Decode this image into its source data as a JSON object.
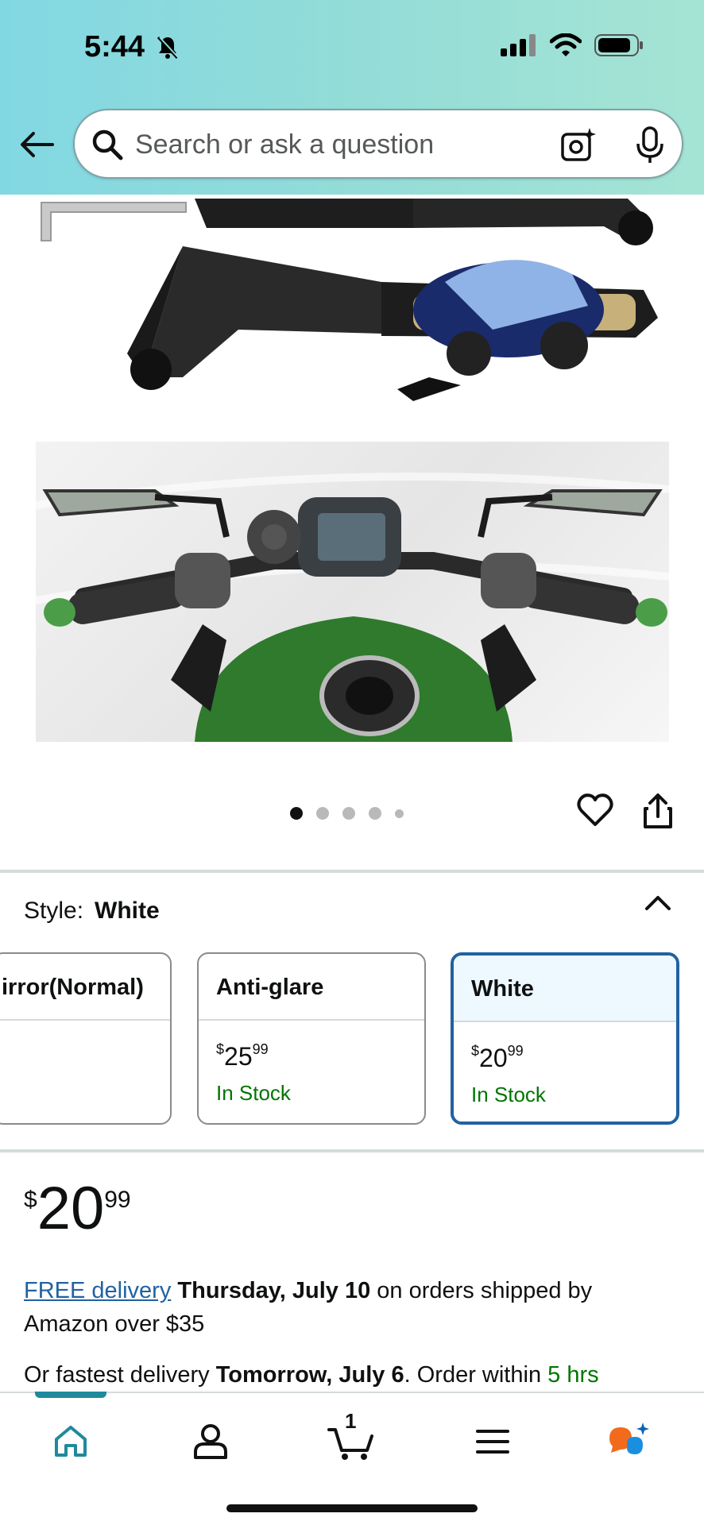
{
  "status_bar": {
    "time": "5:44"
  },
  "search": {
    "placeholder": "Search or ask a question"
  },
  "gallery": {
    "dot_count": 5,
    "active_index": 0
  },
  "style": {
    "label": "Style:",
    "selected": "White",
    "options": [
      {
        "name": "irror(Normal)",
        "price_symbol": "",
        "price_whole": "",
        "price_fraction": "",
        "stock": ""
      },
      {
        "name": "Anti-glare",
        "price_symbol": "$",
        "price_whole": "25",
        "price_fraction": "99",
        "stock": "In Stock"
      },
      {
        "name": "White",
        "price_symbol": "$",
        "price_whole": "20",
        "price_fraction": "99",
        "stock": "In Stock"
      }
    ]
  },
  "price": {
    "symbol": "$",
    "whole": "20",
    "fraction": "99"
  },
  "delivery": {
    "link": "FREE delivery",
    "date": "Thursday, July 10",
    "rest": "on orders shipped by Amazon over $35"
  },
  "fastest": {
    "prefix": "Or fastest delivery",
    "date": "Tomorrow, July 6",
    "middle": ". Order within",
    "time_left": "5 hrs"
  },
  "nav": {
    "cart_count": "1"
  },
  "colors": {
    "accent_teal": "#1f8a9c",
    "link_blue": "#2162a1",
    "stock_green": "#007600",
    "selected_border": "#2162a1"
  }
}
